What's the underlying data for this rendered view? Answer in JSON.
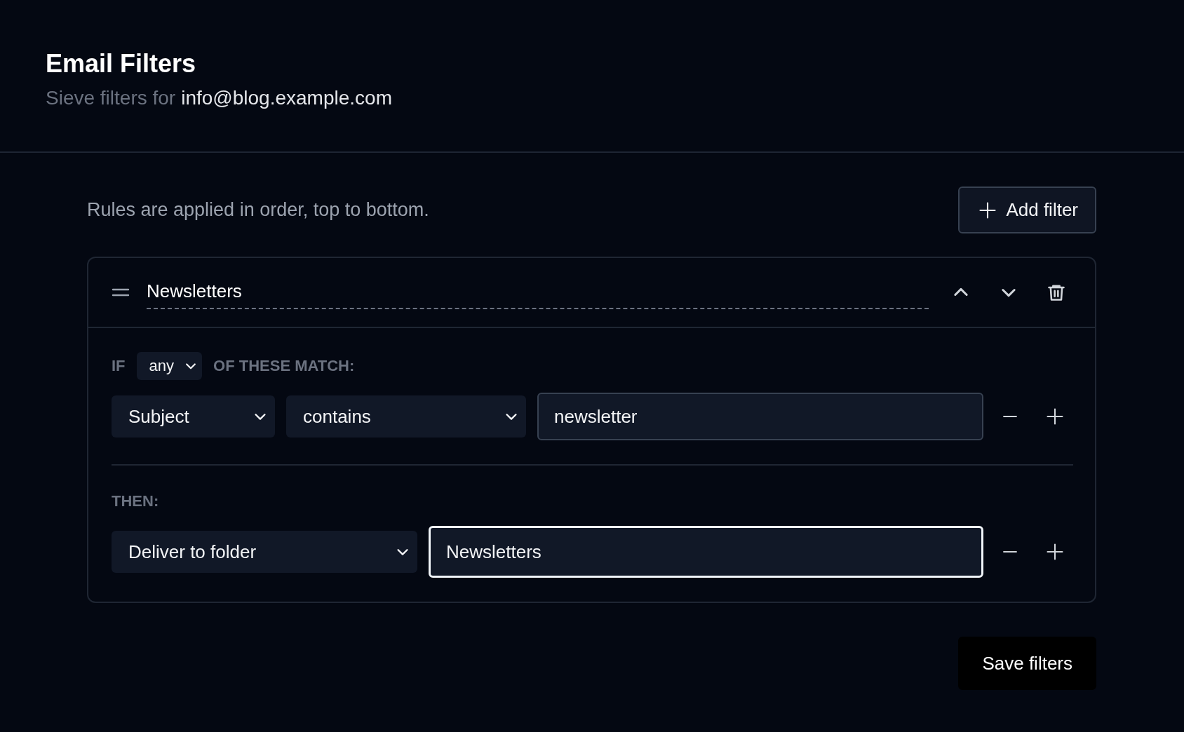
{
  "header": {
    "title": "Email Filters",
    "subtitle_prefix": "Sieve filters for",
    "account": "info@blog.example.com"
  },
  "toolbar": {
    "hint": "Rules are applied in order, top to bottom.",
    "add_button": "Add filter"
  },
  "filters": [
    {
      "name": "Newsletters",
      "if_label": "IF",
      "match_mode": "any",
      "match_suffix": "OF THESE MATCH:",
      "conditions": [
        {
          "field": "Subject",
          "operator": "contains",
          "value": "newsletter",
          "focused": false
        }
      ],
      "then_label": "THEN:",
      "actions": [
        {
          "action": "Deliver to folder",
          "value": "Newsletters",
          "focused": true
        }
      ]
    }
  ],
  "save_button": "Save filters"
}
